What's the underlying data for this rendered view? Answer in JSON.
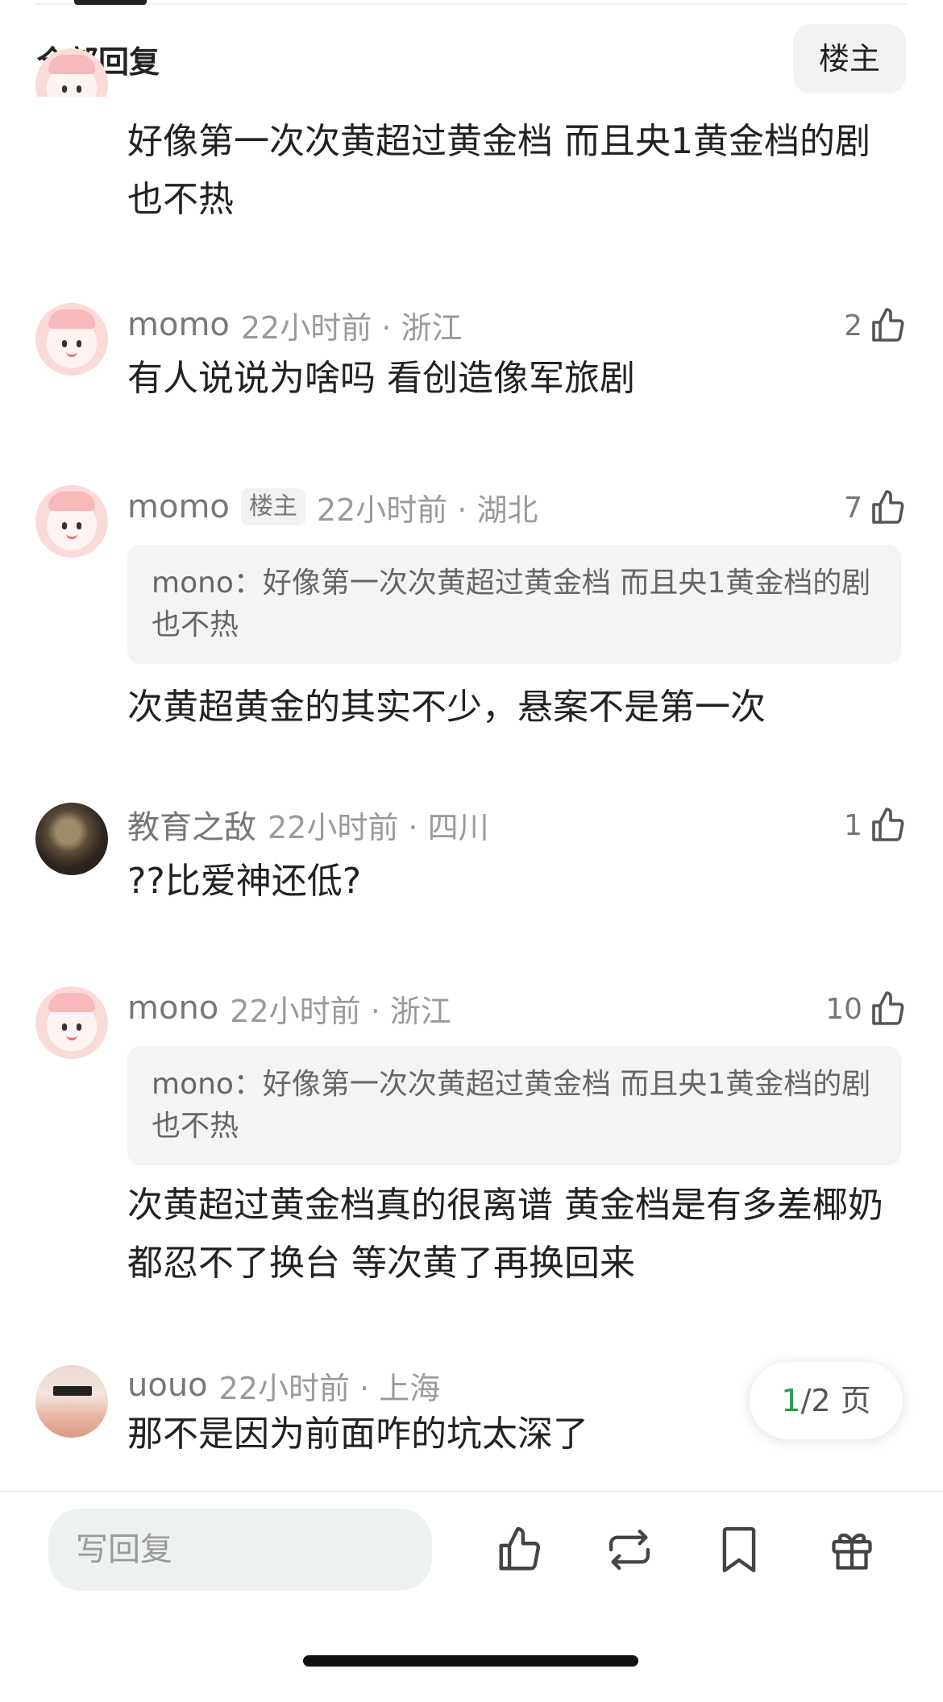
{
  "header": {
    "title": "全部回复",
    "op_filter": "楼主"
  },
  "comments": [
    {
      "text": "好像第一次次黄超过黄金档 而且央1黄金档的剧也不热"
    },
    {
      "username": "momo",
      "time_location": "22小时前 · 浙江",
      "likes": "2",
      "text": "有人说说为啥吗 看创造像军旅剧"
    },
    {
      "username": "momo",
      "badge": "楼主",
      "time_location": "22小时前 · 湖北",
      "likes": "7",
      "quote": "mono：好像第一次次黄超过黄金档 而且央1黄金档的剧也不热",
      "text": "次黄超黄金的其实不少，悬案不是第一次"
    },
    {
      "username": "教育之敌",
      "time_location": "22小时前 · 四川",
      "likes": "1",
      "text": "??比爱神还低?"
    },
    {
      "username": "mono",
      "time_location": "22小时前 · 浙江",
      "likes": "10",
      "quote": "mono：好像第一次次黄超过黄金档 而且央1黄金档的剧也不热",
      "text": "次黄超过黄金档真的很离谱 黄金档是有多差椰奶都忍不了换台 等次黄了再换回来"
    },
    {
      "username": "uouo",
      "time_location": "22小时前 · 上海",
      "text": "那不是因为前面咋的坑太深了"
    }
  ],
  "pager": {
    "current": "1",
    "rest": "/2 页"
  },
  "bottom_bar": {
    "reply_placeholder": "写回复",
    "icons": [
      "thumbs-up-icon",
      "repost-icon",
      "bookmark-icon",
      "gift-icon"
    ]
  },
  "colors": {
    "pager_current": "#2a9a4a",
    "meta": "#9a9a9a",
    "quote_bg": "#f4f4f4"
  }
}
